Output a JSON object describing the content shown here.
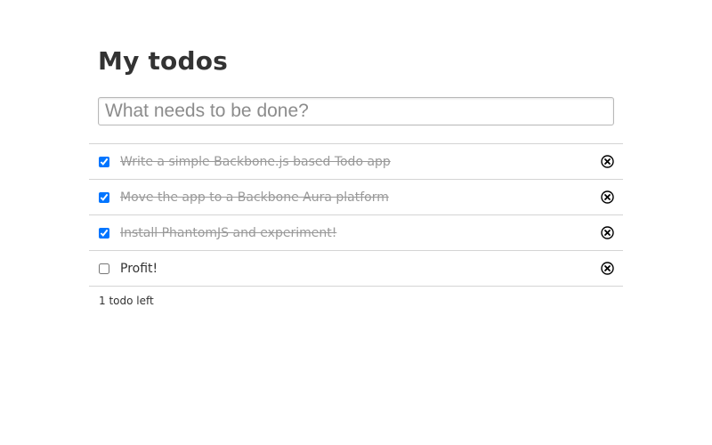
{
  "app": {
    "title": "My todos"
  },
  "new_todo": {
    "placeholder": "What needs to be done?",
    "value": ""
  },
  "todos": [
    {
      "label": "Write a simple Backbone.js based Todo app",
      "done": true
    },
    {
      "label": "Move the app to a Backbone Aura platform",
      "done": true
    },
    {
      "label": "Install PhantomJS and experiment!",
      "done": true
    },
    {
      "label": "Profit!",
      "done": false
    }
  ],
  "footer": {
    "count_text": "1 todo left"
  },
  "icons": {
    "destroy": "close-circle-icon"
  }
}
